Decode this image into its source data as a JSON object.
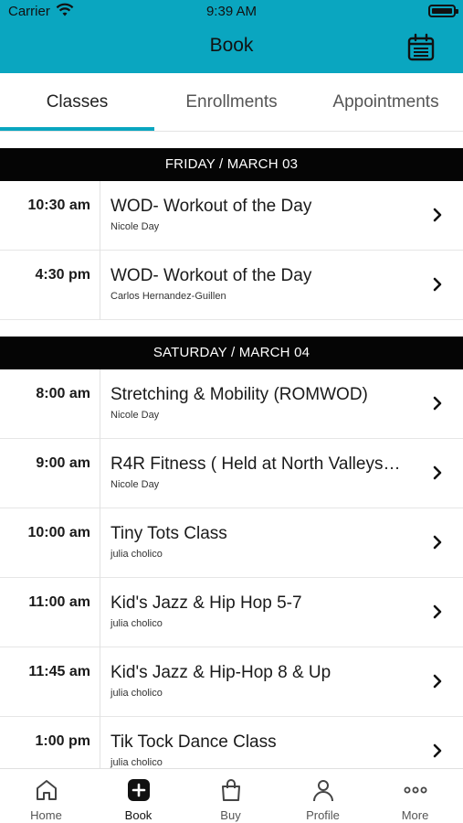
{
  "status_bar": {
    "carrier": "Carrier",
    "time": "9:39 AM"
  },
  "header": {
    "title": "Book",
    "calendar_icon": "calendar-icon"
  },
  "colors": {
    "accent": "#0aa6c0",
    "day_header_bg": "#050505"
  },
  "tabs": [
    {
      "label": "Classes",
      "active": true
    },
    {
      "label": "Enrollments",
      "active": false
    },
    {
      "label": "Appointments",
      "active": false
    }
  ],
  "days": [
    {
      "label": "FRIDAY / MARCH 03",
      "classes": [
        {
          "time": "10:30 am",
          "title": "WOD- Workout of the Day",
          "instructor": "Nicole Day"
        },
        {
          "time": "4:30 pm",
          "title": "WOD- Workout of the Day",
          "instructor": "Carlos Hernandez-Guillen"
        }
      ]
    },
    {
      "label": "SATURDAY / MARCH 04",
      "classes": [
        {
          "time": "8:00 am",
          "title": "Stretching & Mobility (ROMWOD)",
          "instructor": "Nicole Day"
        },
        {
          "time": "9:00 am",
          "title": "R4R Fitness ( Held at North Valleys…",
          "instructor": "Nicole Day"
        },
        {
          "time": "10:00 am",
          "title": "Tiny Tots Class",
          "instructor": "julia cholico"
        },
        {
          "time": "11:00 am",
          "title": "Kid's Jazz & Hip Hop 5-7",
          "instructor": "julia cholico"
        },
        {
          "time": "11:45 am",
          "title": "Kid's Jazz & Hip-Hop 8 & Up",
          "instructor": "julia cholico"
        },
        {
          "time": "1:00 pm",
          "title": "Tik Tock Dance Class",
          "instructor": "julia cholico"
        }
      ]
    }
  ],
  "tabbar": [
    {
      "label": "Home",
      "icon": "home-icon",
      "active": false
    },
    {
      "label": "Book",
      "icon": "plus-square-icon",
      "active": true
    },
    {
      "label": "Buy",
      "icon": "shopping-bag-icon",
      "active": false
    },
    {
      "label": "Profile",
      "icon": "person-icon",
      "active": false
    },
    {
      "label": "More",
      "icon": "more-dots-icon",
      "active": false
    }
  ]
}
